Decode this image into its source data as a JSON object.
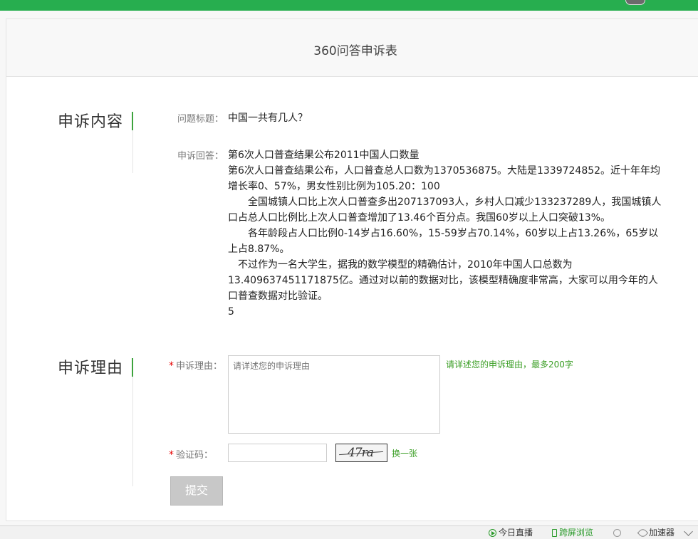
{
  "form": {
    "title": "360问答申诉表"
  },
  "content_section": {
    "heading": "申诉内容",
    "question_label": "问题标题：",
    "question": "中国一共有几人？",
    "answer_label": "申诉回答：",
    "answer_lines": [
      "第6次人口普查结果公布2011中国人口数量",
      "第6次人口普查结果公布，人口普查总人口数为1370536875。大陆是1339724852。近十年年均增长率0、57%，男女性别比例为105.20：100",
      "　　全国城镇人口比上次人口普查多出207137093人，乡村人口减少133237289人，我国城镇人口占总人口比例比上次人口普查增加了13.46个百分点。我国60岁以上人口突破13%。",
      "　　各年龄段占人口比例0-14岁占16.60%，15-59岁占70.14%，60岁以上占13.26%，65岁以上占8.87%。",
      "　不过作为一名大学生，据我的数学模型的精确估计，2010年中国人口总数为13.409637451171875亿。通过对以前的数据对比，该模型精确度非常高，大家可以用今年的人口普查数据对比验证。",
      "5"
    ]
  },
  "reason_section": {
    "heading": "申诉理由",
    "required_mark": "*",
    "reason_label": "申诉理由：",
    "reason_placeholder": "请详述您的申诉理由",
    "reason_hint": "请详述您的申诉理由，最多200字",
    "captcha_label": "验证码：",
    "captcha_value": "",
    "captcha_image_text": "47ra",
    "refresh_label": "换一张",
    "submit_label": "提交"
  },
  "statusbar": {
    "items": [
      {
        "label": "今日直播",
        "icon": "play-icon"
      },
      {
        "label": "跨屏浏览",
        "icon": "phone-icon"
      },
      {
        "label": "",
        "icon": "refresh-circle-icon"
      },
      {
        "label": "加速器",
        "icon": "rocket-icon"
      }
    ]
  },
  "colors": {
    "topbar": "#27ae4f",
    "accent_green": "#3a9e24",
    "required_red": "#e60000",
    "submit_disabled": "#c8c8c8"
  }
}
